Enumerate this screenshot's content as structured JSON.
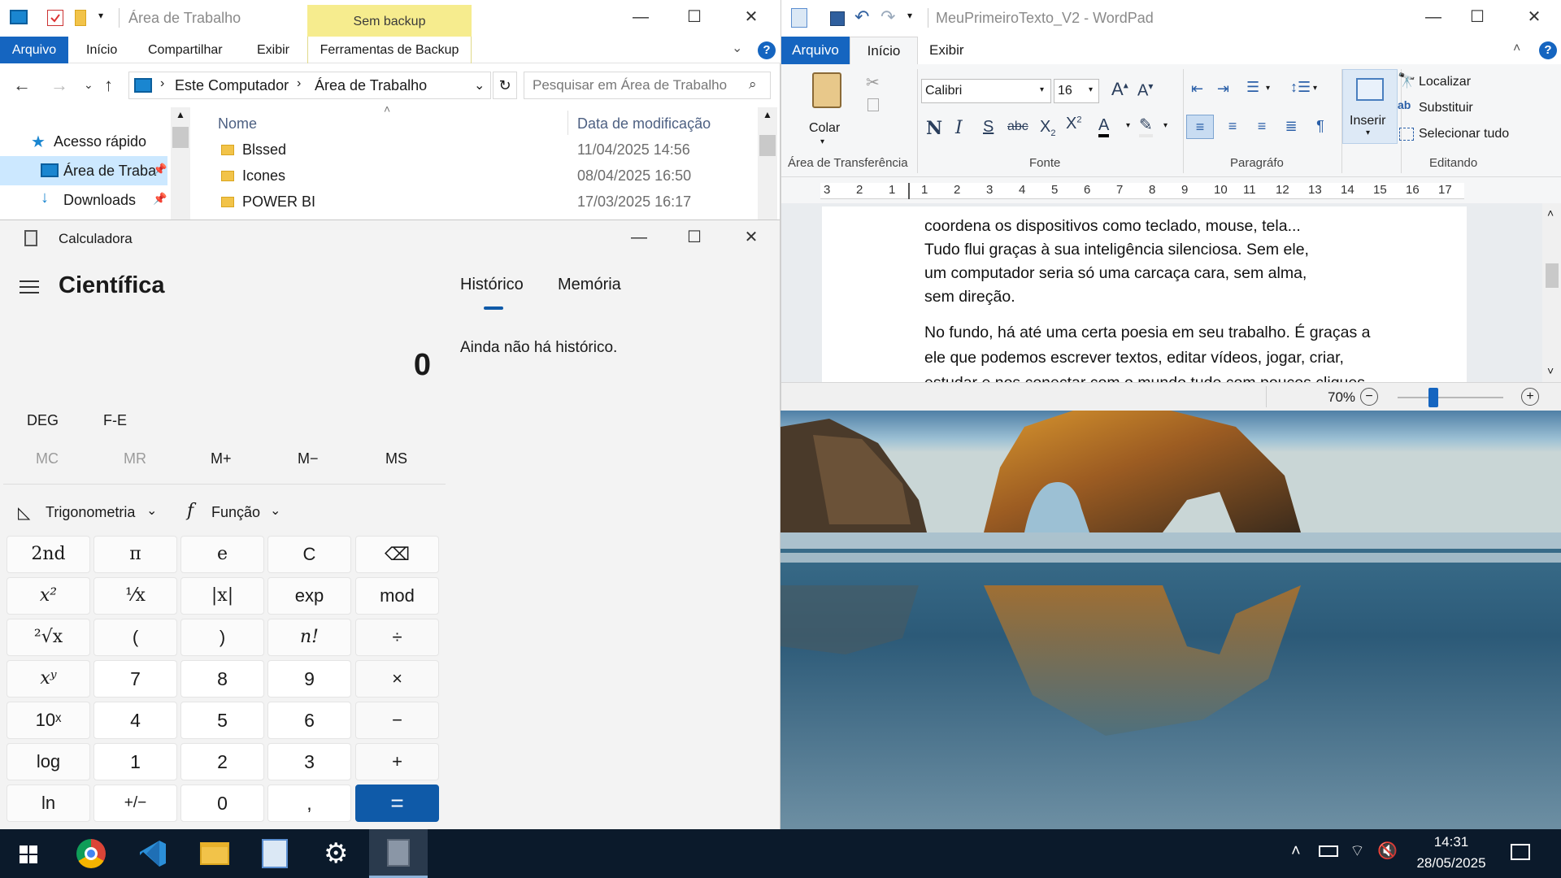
{
  "explorer": {
    "title": "Área de Trabalho",
    "context_tab": "Sem backup",
    "tabs": [
      "Arquivo",
      "Início",
      "Compartilhar",
      "Exibir",
      "Ferramentas de Backup"
    ],
    "breadcrumb": [
      "Este Computador",
      "Área de Trabalho"
    ],
    "search_placeholder": "Pesquisar em Área de Trabalho",
    "nav_items": [
      {
        "label": "Acesso rápido",
        "icon": "star-icon"
      },
      {
        "label": "Área de Traba",
        "icon": "desktop-icon"
      },
      {
        "label": "Downloads",
        "icon": "download-icon"
      }
    ],
    "columns": [
      "Nome",
      "Data de modificação"
    ],
    "rows": [
      {
        "name": "Blssed",
        "date": "11/04/2025 14:56"
      },
      {
        "name": "Icones",
        "date": "08/04/2025 16:50"
      },
      {
        "name": "POWER BI",
        "date": "17/03/2025 16:17"
      }
    ]
  },
  "calculator": {
    "title": "Calculadora",
    "mode": "Científica",
    "display": "0",
    "angle_mode": "DEG",
    "fe_label": "F-E",
    "memory": [
      "MC",
      "MR",
      "M+",
      "M−",
      "MS"
    ],
    "trig_label": "Trigonometria",
    "func_label": "Função",
    "history_tabs": [
      "Histórico",
      "Memória"
    ],
    "history_empty": "Ainda não há histórico.",
    "keys": {
      "r1": [
        "2nd",
        "π",
        "e",
        "C",
        "⌫"
      ],
      "r2": [
        "x²",
        "¹⁄x",
        "|x|",
        "exp",
        "mod"
      ],
      "r3": [
        "²√x",
        "(",
        ")",
        "n!",
        "÷"
      ],
      "r4": [
        "xʸ",
        "7",
        "8",
        "9",
        "×"
      ],
      "r5": [
        "10ˣ",
        "4",
        "5",
        "6",
        "−"
      ],
      "r6": [
        "log",
        "1",
        "2",
        "3",
        "+"
      ],
      "r7": [
        "ln",
        "+/−",
        "0",
        ",",
        "="
      ]
    }
  },
  "wordpad": {
    "title": "MeuPrimeiroTexto_V2 - WordPad",
    "tabs": [
      "Arquivo",
      "Início",
      "Exibir"
    ],
    "clipboard": {
      "paste": "Colar",
      "group": "Área de Transferência"
    },
    "font": {
      "name": "Calibri",
      "size": "16",
      "group": "Fonte"
    },
    "paragraph_group": "Paragráfo",
    "insert_label": "Inserir",
    "editing": {
      "find": "Localizar",
      "replace": "Substituir",
      "select_all": "Selecionar tudo",
      "group": "Editando"
    },
    "ruler": [
      "3",
      "2",
      "1",
      "1",
      "2",
      "3",
      "4",
      "5",
      "6",
      "7",
      "8",
      "9",
      "10",
      "11",
      "12",
      "13",
      "14",
      "15",
      "16",
      "17"
    ],
    "document": {
      "p1": [
        "coordena os dispositivos como teclado, mouse, tela...",
        "Tudo flui graças à sua inteligência silenciosa. Sem ele,",
        "um computador seria só uma carcaça cara, sem alma,",
        "sem direção."
      ],
      "p2": [
        "No fundo, há até uma certa poesia em seu trabalho. É graças a",
        "ele que podemos escrever textos, editar vídeos, jogar, criar,",
        "estudar e nos conectar com o mundo tudo com poucos cliques"
      ]
    },
    "zoom": "70%"
  },
  "taskbar": {
    "apps": [
      "windows-start-icon",
      "chrome-icon",
      "vscode-icon",
      "file-explorer-icon",
      "wordpad-icon",
      "settings-icon",
      "calculator-icon"
    ],
    "time": "14:31",
    "date": "28/05/2025"
  },
  "colors": {
    "accent": "#0f5aa8",
    "ribbon_blue": "#1565c0",
    "context_yellow": "#f6ec8e",
    "taskbar": "#0b1a2b"
  }
}
